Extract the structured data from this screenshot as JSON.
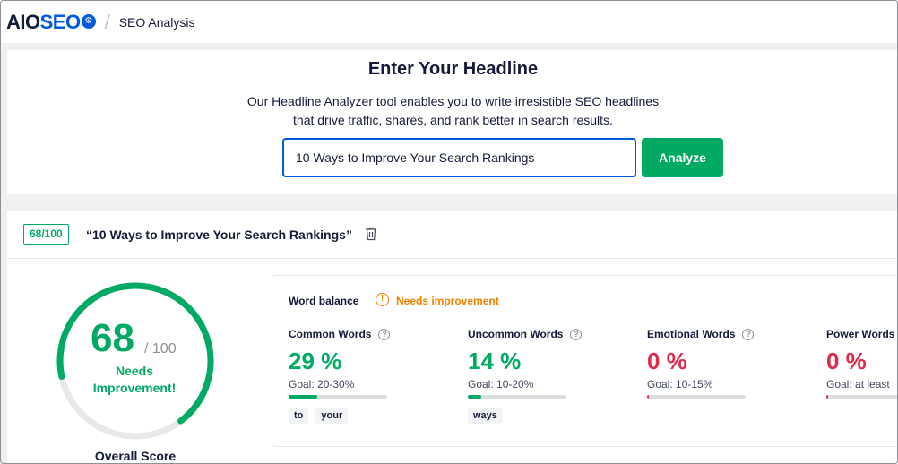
{
  "topbar": {
    "logo_aio": "AIO",
    "logo_seo": "SEO",
    "separator": "/",
    "breadcrumb": "SEO Analysis"
  },
  "headline_section": {
    "title": "Enter Your Headline",
    "description_line1": "Our Headline Analyzer tool enables you to write irresistible SEO headlines",
    "description_line2": "that drive traffic, shares, and rank better in search results.",
    "input_value": "10 Ways to Improve Your Search Rankings",
    "analyze_label": "Analyze"
  },
  "result": {
    "score_badge": "68/100",
    "headline": "“10 Ways to Improve Your Search Rankings”",
    "score": "68",
    "score_max": "/ 100",
    "score_fraction": 0.68,
    "status_line1": "Needs",
    "status_line2": "Improvement!",
    "overall_label": "Overall Score",
    "word_balance_label": "Word balance",
    "word_balance_status": "Needs improvement",
    "metrics": [
      {
        "title": "Common Words",
        "value": "29 %",
        "goal": "Goal: 20-30%",
        "progress": 0.29,
        "color": "#00aa63",
        "chips": [
          "to",
          "your"
        ]
      },
      {
        "title": "Uncommon Words",
        "value": "14 %",
        "goal": "Goal: 10-20%",
        "progress": 0.14,
        "color": "#00aa63",
        "chips": [
          "ways"
        ]
      },
      {
        "title": "Emotional Words",
        "value": "0 %",
        "goal": "Goal: 10-15%",
        "progress": 0,
        "color": "#df2a4a",
        "chips": []
      },
      {
        "title": "Power Words",
        "value": "0 %",
        "goal": "Goal: at least",
        "progress": 0,
        "color": "#df2a4a",
        "chips": []
      }
    ]
  },
  "colors": {
    "accent_green": "#00aa63",
    "brand_blue": "#005ae0",
    "warning_orange": "#f18200",
    "error_red": "#df2a4a"
  }
}
